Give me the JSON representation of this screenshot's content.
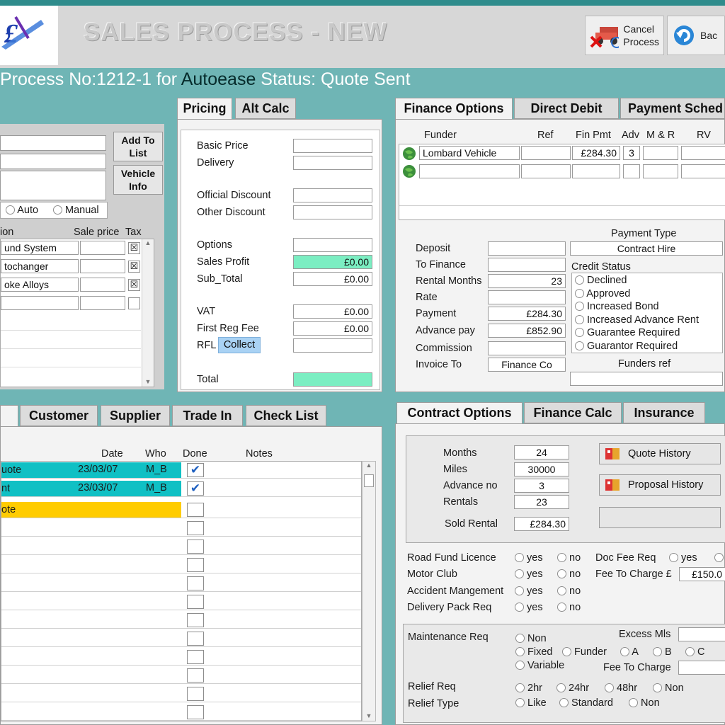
{
  "header": {
    "app_title": "SALES PROCESS - NEW",
    "cancel_label_1": "Cancel",
    "cancel_label_2": "Process",
    "back_label": "Bac"
  },
  "status_line": {
    "prefix": "Process No:1212-1 for ",
    "company": "Autoease",
    "status": " Status: Quote Sent"
  },
  "left_top": {
    "add_to_list_1": "Add To",
    "add_to_list_2": "List",
    "vehicle_info_1": "Vehicle",
    "vehicle_info_2": "Info",
    "radio_auto": "Auto",
    "radio_manual": "Manual",
    "col_option": "ion",
    "col_sale_price": "Sale price",
    "col_tax": "Tax",
    "options": [
      "und System",
      "tochanger",
      "oke Alloys"
    ]
  },
  "pricing": {
    "tabs": [
      "Pricing",
      "Alt Calc"
    ],
    "basic_price": "Basic Price",
    "delivery": "Delivery",
    "official_discount": "Official Discount",
    "other_discount": "Other Discount",
    "options": "Options",
    "sales_profit": "Sales Profit",
    "sales_profit_value": "£0.00",
    "sub_total": "Sub_Total",
    "sub_total_value": "£0.00",
    "vat": "VAT",
    "vat_value": "£0.00",
    "first_reg_fee": "First Reg Fee",
    "first_reg_fee_value": "£0.00",
    "rfl": "RFL",
    "collect": "Collect",
    "total": "Total"
  },
  "finance": {
    "tabs": [
      "Finance Options",
      "Direct Debit",
      "Payment Sched"
    ],
    "col_funder": "Funder",
    "col_ref": "Ref",
    "col_fin_pmt": "Fin Pmt",
    "col_adv": "Adv",
    "col_mr": "M & R",
    "col_rv": "RV",
    "funder_name": "Lombard Vehicle",
    "fin_pmt": "£284.30",
    "adv": "3",
    "deposit": "Deposit",
    "to_finance": "To Finance",
    "rental_months": "Rental Months",
    "rental_months_value": "23",
    "rate": "Rate",
    "payment": "Payment",
    "payment_value": "£284.30",
    "advance_pay": "Advance pay",
    "advance_pay_value": "£852.90",
    "commission": "Commission",
    "invoice_to": "Invoice To",
    "invoice_to_value": "Finance Co",
    "payment_type": "Payment Type",
    "payment_type_value": "Contract Hire",
    "credit_status": "Credit Status",
    "credit_options": [
      "Declined",
      "Approved",
      "Increased Bond",
      "Increased Advance Rent",
      "Guarantee Required",
      "Guarantor Required"
    ],
    "funders_ref": "Funders ref"
  },
  "bottom_left": {
    "tabs": [
      "Customer",
      "Supplier",
      "Trade In",
      "Check List"
    ],
    "col_date": "Date",
    "col_who": "Who",
    "col_done": "Done",
    "col_notes": "Notes",
    "rows": [
      {
        "name": "uote",
        "date": "23/03/07",
        "who": "M_B",
        "done": "✔"
      },
      {
        "name": "nt",
        "date": "23/03/07",
        "who": "M_B",
        "done": "✔"
      },
      {
        "name": "ote",
        "date": "",
        "who": "",
        "done": ""
      }
    ]
  },
  "contract": {
    "tabs": [
      "Contract Options",
      "Finance Calc",
      "Insurance"
    ],
    "months": "Months",
    "months_value": "24",
    "miles": "Miles",
    "miles_value": "30000",
    "advance_no": "Advance no",
    "advance_no_value": "3",
    "rentals": "Rentals",
    "rentals_value": "23",
    "sold_rental": "Sold Rental",
    "sold_rental_value": "£284.30",
    "quote_history": "Quote History",
    "proposal_history": "Proposal History",
    "road_fund_licence": "Road Fund Licence",
    "motor_club": "Motor Club",
    "accident_mangement": "Accident Mangement",
    "delivery_pack_req": "Delivery Pack Req",
    "yes": "yes",
    "no": "no",
    "doc_fee_req": "Doc Fee Req",
    "fee_to_charge_pound": "Fee To Charge £",
    "fee_to_charge_value": "£150.0",
    "maintenance_req": "Maintenance Req",
    "m_non": "Non",
    "m_fixed": "Fixed",
    "m_funder": "Funder",
    "m_a": "A",
    "m_b": "B",
    "m_c": "C",
    "m_variable": "Variable",
    "excess_mls": "Excess Mls",
    "fee_to_charge": "Fee To Charge",
    "relief_req": "Relief Req",
    "relief_type": "Relief Type",
    "r_2hr": "2hr",
    "r_24hr": "24hr",
    "r_48hr": "48hr",
    "r_non": "Non",
    "r_like": "Like",
    "r_standard": "Standard",
    "r_non2": "Non"
  },
  "colors": {
    "teal_row": "#10c0c4",
    "yellow_row": "#ffcc00",
    "mint_field": "#7beec2",
    "background": "#6fb5b5"
  }
}
